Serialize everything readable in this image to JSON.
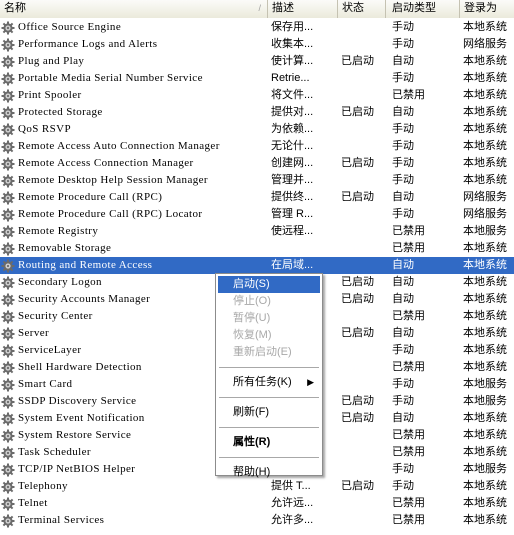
{
  "header": {
    "name": "名称",
    "sort_indicator": "/",
    "description": "描述",
    "status": "状态",
    "startup_type": "启动类型",
    "logon_as": "登录为"
  },
  "rows": [
    {
      "name": "Office Source Engine",
      "description": "保存用...",
      "status": "",
      "startup": "手动",
      "logon": "本地系统"
    },
    {
      "name": "Performance Logs and Alerts",
      "description": "收集本...",
      "status": "",
      "startup": "手动",
      "logon": "网络服务"
    },
    {
      "name": "Plug and Play",
      "description": "使计算...",
      "status": "已启动",
      "startup": "自动",
      "logon": "本地系统"
    },
    {
      "name": "Portable Media Serial Number Service",
      "description": "Retrie...",
      "status": "",
      "startup": "手动",
      "logon": "本地系统"
    },
    {
      "name": "Print Spooler",
      "description": "将文件...",
      "status": "",
      "startup": "已禁用",
      "logon": "本地系统"
    },
    {
      "name": "Protected Storage",
      "description": "提供对...",
      "status": "已启动",
      "startup": "自动",
      "logon": "本地系统"
    },
    {
      "name": "QoS RSVP",
      "description": "为依赖...",
      "status": "",
      "startup": "手动",
      "logon": "本地系统"
    },
    {
      "name": "Remote Access Auto Connection Manager",
      "description": "无论什...",
      "status": "",
      "startup": "手动",
      "logon": "本地系统"
    },
    {
      "name": "Remote Access Connection Manager",
      "description": "创建网...",
      "status": "已启动",
      "startup": "手动",
      "logon": "本地系统"
    },
    {
      "name": "Remote Desktop Help Session Manager",
      "description": "管理并...",
      "status": "",
      "startup": "手动",
      "logon": "本地系统"
    },
    {
      "name": "Remote Procedure Call (RPC)",
      "description": "提供终...",
      "status": "已启动",
      "startup": "自动",
      "logon": "网络服务"
    },
    {
      "name": "Remote Procedure Call (RPC) Locator",
      "description": "管理 R...",
      "status": "",
      "startup": "手动",
      "logon": "网络服务"
    },
    {
      "name": "Remote Registry",
      "description": "使远程...",
      "status": "",
      "startup": "已禁用",
      "logon": "本地服务"
    },
    {
      "name": "Removable Storage",
      "description": "",
      "status": "",
      "startup": "已禁用",
      "logon": "本地系统"
    },
    {
      "name": "Routing and Remote Access",
      "description": "在局域...",
      "status": "",
      "startup": "自动",
      "logon": "本地系统",
      "selected": true
    },
    {
      "name": "Secondary Logon",
      "description": "",
      "status": "已启动",
      "startup": "自动",
      "logon": "本地系统"
    },
    {
      "name": "Security Accounts Manager",
      "description": "",
      "status": "已启动",
      "startup": "自动",
      "logon": "本地系统"
    },
    {
      "name": "Security Center",
      "description": "",
      "status": "",
      "startup": "已禁用",
      "logon": "本地系统"
    },
    {
      "name": "Server",
      "description": "",
      "status": "已启动",
      "startup": "自动",
      "logon": "本地系统"
    },
    {
      "name": "ServiceLayer",
      "description": "",
      "status": "",
      "startup": "手动",
      "logon": "本地系统"
    },
    {
      "name": "Shell Hardware Detection",
      "description": "",
      "status": "",
      "startup": "已禁用",
      "logon": "本地系统"
    },
    {
      "name": "Smart Card",
      "description": "",
      "status": "",
      "startup": "手动",
      "logon": "本地服务"
    },
    {
      "name": "SSDP Discovery Service",
      "description": "",
      "status": "已启动",
      "startup": "手动",
      "logon": "本地服务"
    },
    {
      "name": "System Event Notification",
      "description": "",
      "status": "已启动",
      "startup": "自动",
      "logon": "本地系统"
    },
    {
      "name": "System Restore Service",
      "description": "",
      "status": "",
      "startup": "已禁用",
      "logon": "本地系统"
    },
    {
      "name": "Task Scheduler",
      "description": "",
      "status": "",
      "startup": "已禁用",
      "logon": "本地系统"
    },
    {
      "name": "TCP/IP NetBIOS Helper",
      "description": "",
      "status": "",
      "startup": "手动",
      "logon": "本地服务"
    },
    {
      "name": "Telephony",
      "description": "提供 T...",
      "status": "已启动",
      "startup": "手动",
      "logon": "本地系统"
    },
    {
      "name": "Telnet",
      "description": "允许远...",
      "status": "",
      "startup": "已禁用",
      "logon": "本地系统"
    },
    {
      "name": "Terminal Services",
      "description": "允许多...",
      "status": "",
      "startup": "已禁用",
      "logon": "本地系统"
    }
  ],
  "context_menu": [
    {
      "label": "启动(S)",
      "highlighted": true
    },
    {
      "label": "停止(O)",
      "disabled": true
    },
    {
      "label": "暂停(U)",
      "disabled": true
    },
    {
      "label": "恢复(M)",
      "disabled": true
    },
    {
      "label": "重新启动(E)",
      "disabled": true
    },
    {
      "separator": true
    },
    {
      "label": "所有任务(K)",
      "submenu": true,
      "submenu_arrow": "▶"
    },
    {
      "separator": true
    },
    {
      "label": "刷新(F)"
    },
    {
      "separator": true
    },
    {
      "label": "属性(R)",
      "bold": true
    },
    {
      "separator": true
    },
    {
      "label": "帮助(H)"
    }
  ],
  "colors": {
    "selection": "#316ac5",
    "header_bg": "#ece9d8",
    "gear_dark": "#6b6b6b",
    "gear_light": "#cfcfcf"
  },
  "icons": {
    "service": "gear-icon",
    "submenu": "chevron-right-icon"
  }
}
